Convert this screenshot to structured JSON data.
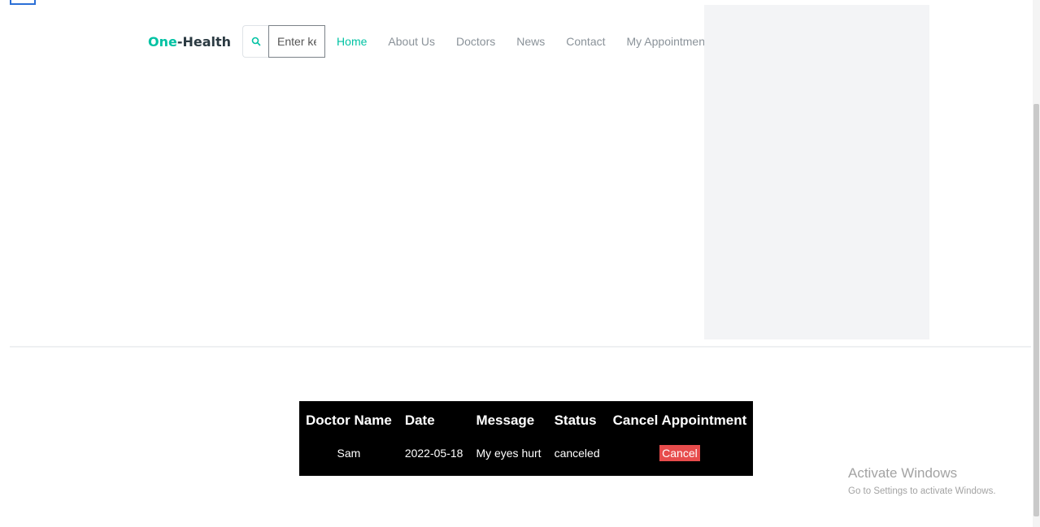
{
  "brand": {
    "prefix": "One",
    "separator": "-",
    "suffix": "Health",
    "accent_color": "#00c2a3"
  },
  "search": {
    "placeholder": "Enter keyword",
    "icon": "search-icon"
  },
  "nav": {
    "items": [
      {
        "label": "Home",
        "active": true
      },
      {
        "label": "About Us",
        "active": false
      },
      {
        "label": "Doctors",
        "active": false
      },
      {
        "label": "News",
        "active": false
      },
      {
        "label": "Contact",
        "active": false
      },
      {
        "label": "My Appointment",
        "active": false
      }
    ]
  },
  "table": {
    "headers": [
      "Doctor Name",
      "Date",
      "Message",
      "Status",
      "Cancel Appointment"
    ],
    "rows": [
      {
        "doctor": "Sam",
        "date": "2022-05-18",
        "message": "My eyes hurt",
        "status": "canceled",
        "action_label": "Cancel"
      }
    ],
    "cancel_color": "#e74c4c"
  },
  "watermark": {
    "title": "Activate Windows",
    "subtitle": "Go to Settings to activate Windows."
  }
}
